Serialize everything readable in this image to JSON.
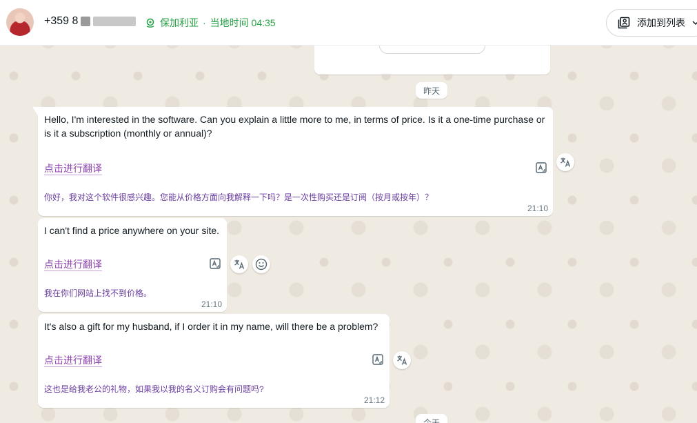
{
  "header": {
    "phone_prefix": "+359 8",
    "country": "保加利亚",
    "separator": "·",
    "local_time": "当地时间 04:35",
    "add_to_list_label": "添加到列表"
  },
  "date_separators": {
    "yesterday": "昨天",
    "today": "今天"
  },
  "messages": [
    {
      "text": "Hello, I'm interested in the software. Can you explain a little more to me, in terms of price. Is it a one-time purchase or is it a subscription (monthly or annual)?",
      "translate_label": "点击进行翻译",
      "translation": "你好，我对这个软件很感兴趣。您能从价格方面向我解释一下吗？是一次性购买还是订阅（按月或按年）？",
      "time": "21:10"
    },
    {
      "text": "I can't find a price anywhere on your site.",
      "translate_label": "点击进行翻译",
      "translation": "我在你们网站上找不到价格。",
      "time": "21:10"
    },
    {
      "text": "It's also a gift for my husband, if I order it in my name, will there be a problem?",
      "translate_label": "点击进行翻译",
      "translation": "这也是给我老公的礼物，如果我以我的名义订购会有问题吗?",
      "time": "21:12"
    }
  ],
  "colors": {
    "accent_green": "#25a244",
    "translate_purple": "#8e44ad",
    "chat_background": "#efeae2"
  }
}
